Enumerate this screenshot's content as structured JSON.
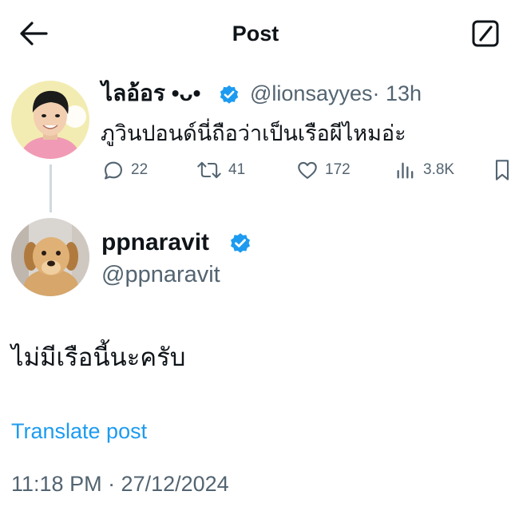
{
  "header": {
    "title": "Post",
    "back_icon": "arrow-left-icon",
    "compose_icon": "compose-icon"
  },
  "parent_post": {
    "display_name": "ไลอ้อร •ᴗ•",
    "handle": "@lionsayyes",
    "time": "· 13h",
    "verified": true,
    "text": "ภูวินปอนด์นี่ถือว่าเป็นเรือผีไหมอ่ะ",
    "stats": {
      "replies": "22",
      "reposts": "41",
      "likes": "172",
      "views": "3.8K"
    }
  },
  "main_post": {
    "display_name": "ppnaravit",
    "handle": "@ppnaravit",
    "verified": true,
    "text": "ไม่มีเรือนี้นะครับ",
    "translate_label": "Translate post",
    "timestamp": "11:18 PM · 27/12/2024"
  },
  "colors": {
    "text": "#0f1419",
    "secondary": "#536471",
    "link": "#1d9bf0",
    "verified": "#1d9bf0",
    "thread_line": "#cfd9de"
  }
}
